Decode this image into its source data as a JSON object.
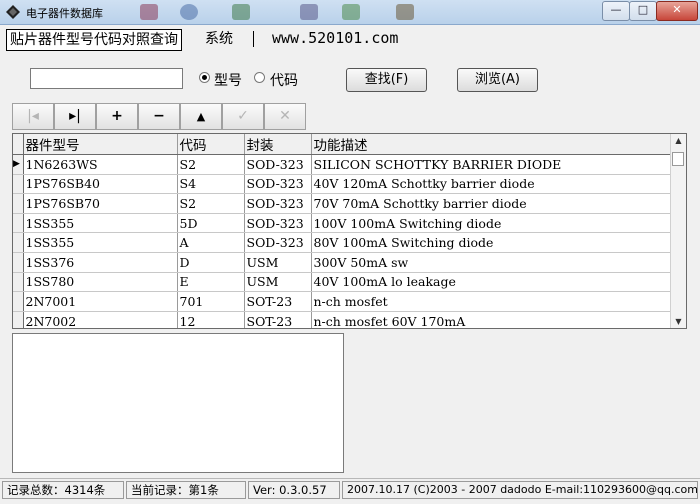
{
  "window": {
    "title": "电子器件数据库",
    "controls": {
      "minimize": "—",
      "maximize": "□",
      "close": "✕"
    }
  },
  "tabs": [
    {
      "label": "贴片器件型号代码对照查询",
      "active": true
    },
    {
      "label": "系统",
      "active": false
    }
  ],
  "website": "www.520101.com",
  "search": {
    "value": "",
    "radio_model": {
      "label": "型号",
      "checked": true
    },
    "radio_code": {
      "label": "代码",
      "checked": false
    },
    "find_button": "查找(F)",
    "browse_button": "浏览(A)"
  },
  "navigator": [
    {
      "icon": "first-record-icon",
      "glyph": "|◂",
      "enabled": false
    },
    {
      "icon": "last-record-icon",
      "glyph": "▸|",
      "enabled": true
    },
    {
      "icon": "insert-icon",
      "glyph": "+",
      "enabled": true
    },
    {
      "icon": "delete-icon",
      "glyph": "−",
      "enabled": true
    },
    {
      "icon": "edit-icon",
      "glyph": "▲",
      "enabled": true
    },
    {
      "icon": "post-icon",
      "glyph": "✓",
      "enabled": false
    },
    {
      "icon": "cancel-icon",
      "glyph": "✕",
      "enabled": false
    }
  ],
  "grid": {
    "columns": [
      "器件型号",
      "代码",
      "封装",
      "功能描述"
    ],
    "rows": [
      [
        "1N6263WS",
        "S2",
        "SOD-323",
        "SILICON SCHOTTKY BARRIER DIODE"
      ],
      [
        "1PS76SB40",
        "S4",
        "SOD-323",
        "40V 120mA Schottky barrier diode"
      ],
      [
        "1PS76SB70",
        "S2",
        "SOD-323",
        "70V 70mA Schottky barrier diode"
      ],
      [
        "1SS355",
        "5D",
        "SOD-323",
        "100V 100mA Switching diode"
      ],
      [
        "1SS355",
        "A",
        "SOD-323",
        "80V 100mA Switching diode"
      ],
      [
        "1SS376",
        "D",
        "USM",
        "300V 50mA sw"
      ],
      [
        "1SS780",
        "E",
        "USM",
        "40V 100mA lo leakage"
      ],
      [
        "2N7001",
        "701",
        "SOT-23",
        "n-ch mosfet"
      ],
      [
        "2N7002",
        "12",
        "SOT-23",
        "n-ch mosfet 60V 170mA"
      ]
    ],
    "current_row": 0,
    "row_indicator": "▶"
  },
  "status": {
    "total": "记录总数：4314条",
    "current": "当前记录：第1条",
    "version": "Ver: 0.3.0.57",
    "copyright": "2007.10.17 (C)2003 - 2007  dadodo  E-mail:110293600@qq.com"
  },
  "colors": {
    "titlebar": "#b9d1ea",
    "window_bg": "#f0f0f0",
    "close": "#c7463a"
  }
}
